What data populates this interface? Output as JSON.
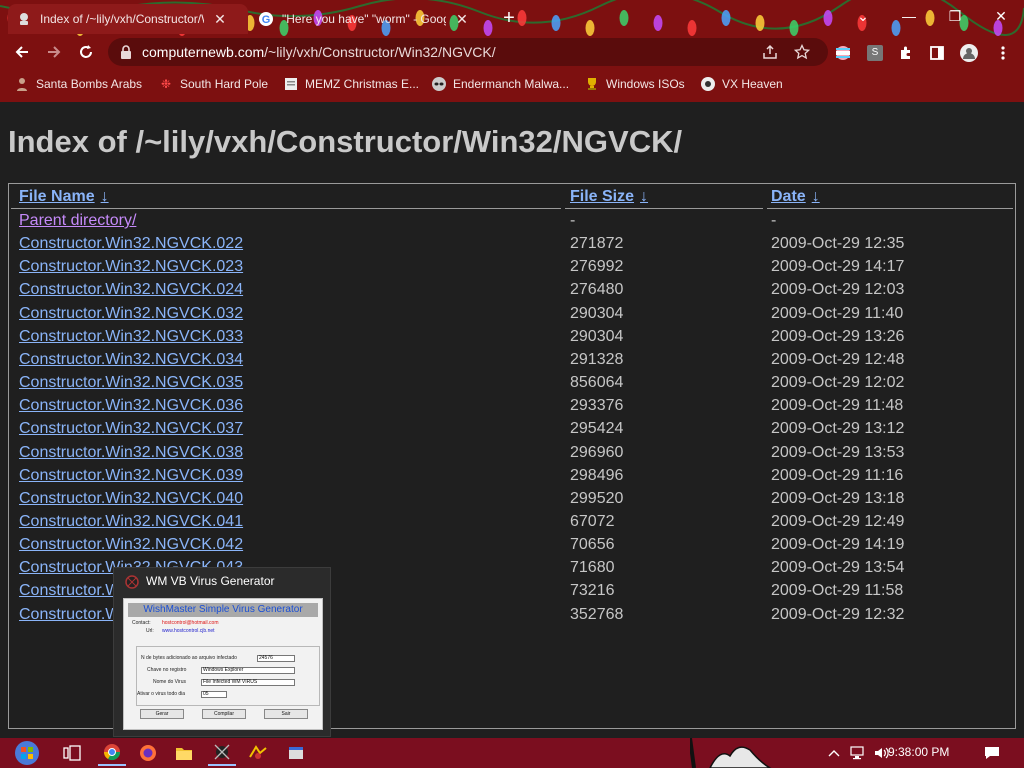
{
  "browser": {
    "tabs": [
      {
        "title": "Index of /~lily/vxh/Constructor/W",
        "active": true
      },
      {
        "title": "\"Here you have\" \"worm\" - Goog",
        "active": false
      }
    ],
    "new_tab_label": "+",
    "window_controls": {
      "tab_search": "⌄",
      "minimize": "—",
      "restore": "❐",
      "close": "✕"
    },
    "url": {
      "host": "computernewb.com",
      "path": "/~lily/vxh/Constructor/Win32/NGVCK/"
    },
    "extension_badge": "S",
    "bookmarks": [
      {
        "label": "Santa Bombs Arabs",
        "icon": "user-icon"
      },
      {
        "label": "South Hard Pole",
        "icon": "snowflake-icon"
      },
      {
        "label": "MEMZ Christmas E...",
        "icon": "page-icon"
      },
      {
        "label": "Endermanch Malwa...",
        "icon": "raccoon-icon"
      },
      {
        "label": "Windows ISOs",
        "icon": "trophy-icon"
      },
      {
        "label": "VX Heaven",
        "icon": "vx-icon"
      }
    ],
    "colors": {
      "chrome": "#7d1010",
      "tab_active": "#8e1a1a",
      "omnibox": "#5a0c0c"
    }
  },
  "page": {
    "title": "Index of /~lily/vxh/Constructor/Win32/NGVCK/",
    "columns": {
      "name": "File Name",
      "size": "File Size",
      "date": "Date",
      "sort_arrow": "↓"
    },
    "rows": [
      {
        "name": "Parent directory/",
        "size": "-",
        "date": "-",
        "visited": true
      },
      {
        "name": "Constructor.Win32.NGVCK.022",
        "size": "271872",
        "date": "2009-Oct-29 12:35"
      },
      {
        "name": "Constructor.Win32.NGVCK.023",
        "size": "276992",
        "date": "2009-Oct-29 14:17"
      },
      {
        "name": "Constructor.Win32.NGVCK.024",
        "size": "276480",
        "date": "2009-Oct-29 12:03"
      },
      {
        "name": "Constructor.Win32.NGVCK.032",
        "size": "290304",
        "date": "2009-Oct-29 11:40"
      },
      {
        "name": "Constructor.Win32.NGVCK.033",
        "size": "290304",
        "date": "2009-Oct-29 13:26"
      },
      {
        "name": "Constructor.Win32.NGVCK.034",
        "size": "291328",
        "date": "2009-Oct-29 12:48"
      },
      {
        "name": "Constructor.Win32.NGVCK.035",
        "size": "856064",
        "date": "2009-Oct-29 12:02"
      },
      {
        "name": "Constructor.Win32.NGVCK.036",
        "size": "293376",
        "date": "2009-Oct-29 11:48"
      },
      {
        "name": "Constructor.Win32.NGVCK.037",
        "size": "295424",
        "date": "2009-Oct-29 13:12"
      },
      {
        "name": "Constructor.Win32.NGVCK.038",
        "size": "296960",
        "date": "2009-Oct-29 13:53"
      },
      {
        "name": "Constructor.Win32.NGVCK.039",
        "size": "298496",
        "date": "2009-Oct-29 11:16"
      },
      {
        "name": "Constructor.Win32.NGVCK.040",
        "size": "299520",
        "date": "2009-Oct-29 13:18"
      },
      {
        "name": "Constructor.Win32.NGVCK.041",
        "size": "67072",
        "date": "2009-Oct-29 12:49"
      },
      {
        "name": "Constructor.Win32.NGVCK.042",
        "size": "70656",
        "date": "2009-Oct-29 14:19"
      },
      {
        "name": "Constructor.Win32.NGVCK.043",
        "size": "71680",
        "date": "2009-Oct-29 13:54"
      },
      {
        "name": "Constructor.Win32.NGVCK.044",
        "size": "73216",
        "date": "2009-Oct-29 11:58"
      },
      {
        "name": "Constructor.Win32.NGVCK.045",
        "size": "352768",
        "date": "2009-Oct-29 12:32"
      }
    ],
    "colors": {
      "link": "#8ab4f8",
      "visited": "#c58af9",
      "background": "#1f1f1f"
    }
  },
  "thumbnail": {
    "window_title": "WM VB Virus Generator",
    "app": {
      "header": "WishMaster Simple Virus Generator",
      "contact_label": "Contact:",
      "contact_value": "hostcontrol@hotmail.com",
      "url_label": "Url:",
      "url_value": "www.hostcontrol.cjb.net",
      "fields": [
        {
          "label": "N de bytes adicionado ao arquivo infectado",
          "value": "24576"
        },
        {
          "label": "Chave no registro",
          "value": "Windows Explorer"
        },
        {
          "label": "Nome do Virus",
          "value": "File Infected WM VIRUS"
        },
        {
          "label": "Ativar o virus todo dia",
          "value": "05"
        }
      ],
      "buttons": [
        "Gerar",
        "Compilar",
        "Sair"
      ]
    }
  },
  "taskbar": {
    "apps": [
      "start-orb-icon",
      "task-view-icon",
      "chrome-icon",
      "firefox-icon",
      "file-explorer-icon",
      "virus-generator-icon",
      "malware-app-icon",
      "window-app-icon"
    ],
    "clock": "9:38:00 PM",
    "color": "#7b0e1f"
  }
}
